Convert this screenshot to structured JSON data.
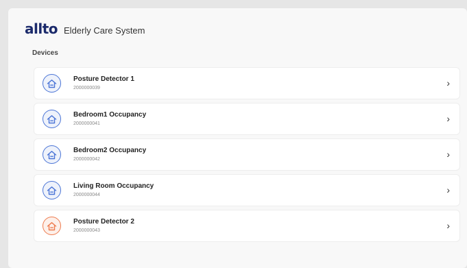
{
  "header": {
    "logo_text": "allto",
    "app_title": "Elderly Care System"
  },
  "devices": {
    "section_label": "Devices",
    "items": [
      {
        "name": "Posture Detector 1",
        "id": "2000000039",
        "icon": "home-shield-icon",
        "icon_color": "#4a74d6",
        "icon_bg": "#eef2fb"
      },
      {
        "name": "Bedroom1 Occupancy",
        "id": "2000000041",
        "icon": "home-shield-icon",
        "icon_color": "#4a74d6",
        "icon_bg": "#eef2fb"
      },
      {
        "name": "Bedroom2 Occupancy",
        "id": "2000000042",
        "icon": "home-shield-icon",
        "icon_color": "#4a74d6",
        "icon_bg": "#eef2fb"
      },
      {
        "name": "Living Room Occupancy",
        "id": "2000000044",
        "icon": "home-shield-icon",
        "icon_color": "#4a74d6",
        "icon_bg": "#eef2fb"
      },
      {
        "name": "Posture Detector 2",
        "id": "2000000043",
        "icon": "home-shield-icon",
        "icon_color": "#ee7a4d",
        "icon_bg": "#fdf0ea"
      }
    ],
    "chevron": "›"
  },
  "colors": {
    "brand": "#1b2a6b",
    "panel_bg": "#f8f8f8",
    "page_bg": "#e6e6e6"
  }
}
